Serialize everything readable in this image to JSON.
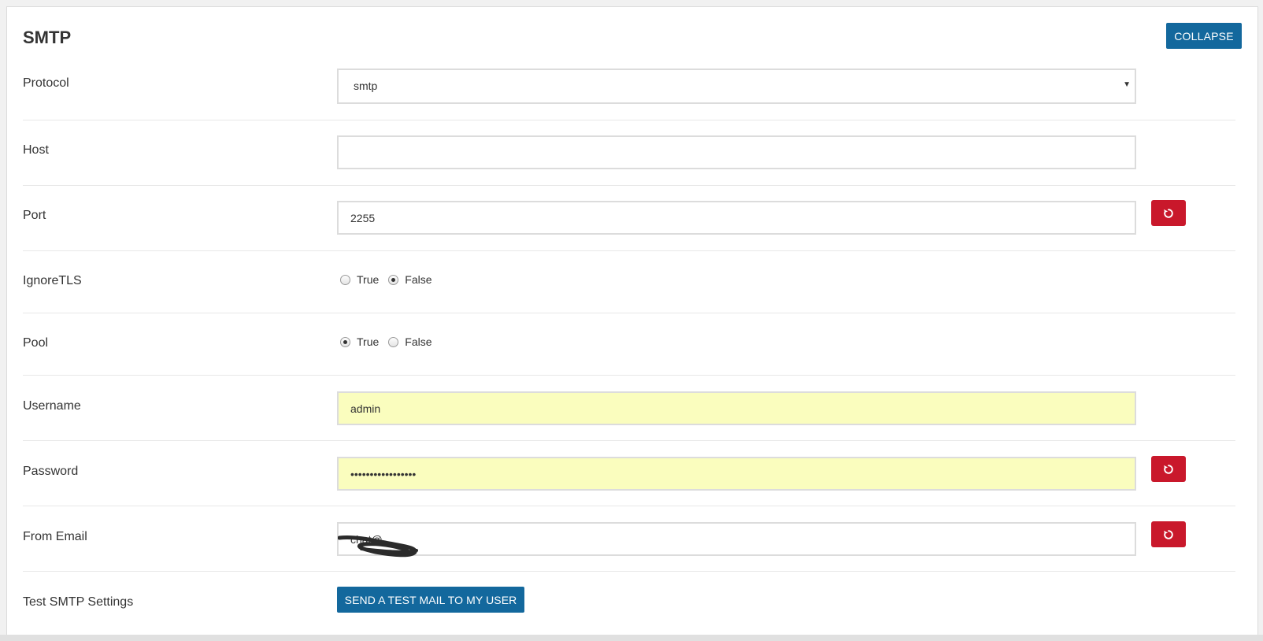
{
  "section": {
    "title": "SMTP",
    "collapse_label": "COLLAPSE"
  },
  "fields": {
    "protocol": {
      "label": "Protocol",
      "value": "smtp"
    },
    "host": {
      "label": "Host",
      "value": ""
    },
    "port": {
      "label": "Port",
      "value": "2255"
    },
    "ignore_tls": {
      "label": "IgnoreTLS",
      "options": [
        "True",
        "False"
      ],
      "selected": "False"
    },
    "pool": {
      "label": "Pool",
      "options": [
        "True",
        "False"
      ],
      "selected": "True"
    },
    "username": {
      "label": "Username",
      "value": "admin"
    },
    "password": {
      "label": "Password",
      "value": "•••••••••••••••••"
    },
    "from_email": {
      "label": "From Email",
      "value": "chat@"
    },
    "test_smtp": {
      "label": "Test SMTP Settings",
      "button_label": "SEND A TEST MAIL TO MY USER"
    }
  },
  "icons": {
    "reset": "undo-icon",
    "caret": "caret-down-icon"
  },
  "colors": {
    "primary": "#13689d",
    "danger": "#c9182b",
    "autofill": "#fafdbe"
  }
}
